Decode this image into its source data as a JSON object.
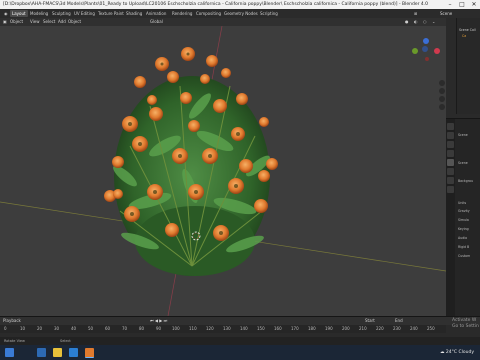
{
  "window": {
    "title": "[D:\\Dropbox\\AHA-FMACS\\3d Models\\Plants\\01_Ready to Upload\\LC20106 Eschscholzia californica - California poppy\\Blender\\ Eschscholzia californica - California poppy (blend)] - Blender 4.0"
  },
  "menu_tabs": [
    "Layout",
    "Modeling",
    "Sculpting",
    "UV Editing",
    "Texture Paint",
    "Shading",
    "Animation",
    "Rendering",
    "Compositing",
    "Geometry Nodes",
    "Scripting"
  ],
  "header": {
    "mode": "Object",
    "view": "View",
    "select": "Select",
    "add": "Add",
    "object": "Object",
    "orientation": "Global"
  },
  "outliner": {
    "title": "Scene",
    "items": [
      "Scene Coll",
      "Ca"
    ]
  },
  "properties": {
    "items": [
      "Scene",
      "Scene",
      "Backgrou",
      "Units",
      "Gravity",
      "Simula",
      "Keying",
      "Audio",
      "Rigid B",
      "Custom"
    ]
  },
  "timeline": {
    "menu": [
      "Playback",
      "Keying",
      "View",
      "Marker"
    ],
    "frame_start_label": "Start",
    "frame_end_label": "End",
    "ticks": [
      "0",
      "10",
      "20",
      "30",
      "40",
      "50",
      "60",
      "70",
      "80",
      "90",
      "100",
      "110",
      "120",
      "130",
      "140",
      "150",
      "160",
      "170",
      "180",
      "190",
      "200",
      "210",
      "220",
      "230",
      "240",
      "250"
    ]
  },
  "status": {
    "left": "Rotate View",
    "right": "Select"
  },
  "activate_windows": {
    "line1": "Activate W",
    "line2": "Go to Settin"
  },
  "taskbar": {
    "temperature": "24°C",
    "weather": "Cloudy"
  },
  "colors": {
    "accent": "#e07a2e",
    "leaf": "#3f7a3a",
    "bg": "#3d3d3d"
  }
}
